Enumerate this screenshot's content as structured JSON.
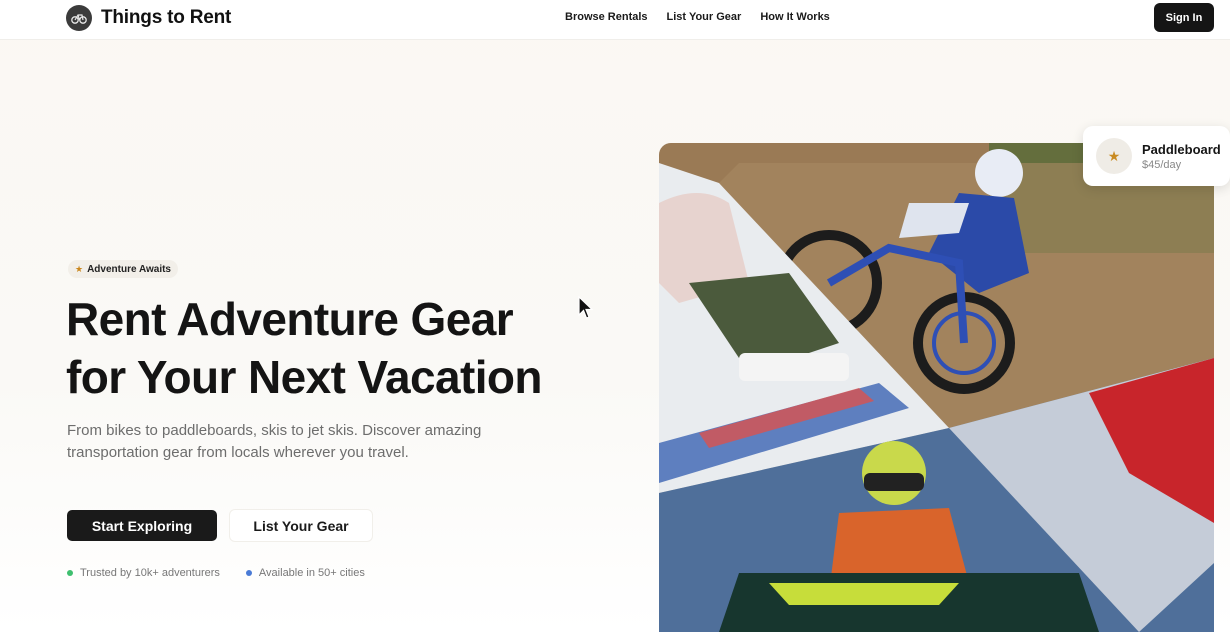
{
  "brand": {
    "name": "Things to Rent",
    "logo_icon": "bicycle-icon"
  },
  "nav": {
    "items": [
      "Browse Rentals",
      "List Your Gear",
      "How It Works"
    ]
  },
  "header": {
    "signin_label": "Sign In"
  },
  "hero": {
    "badge": {
      "icon": "surfer-icon",
      "label": "Adventure Awaits"
    },
    "headline_line1": "Rent Adventure Gear",
    "headline_line2": "for Your Next Vacation",
    "subtitle": "From bikes to paddleboards, skis to jet skis. Discover amazing transportation gear from locals wherever you travel.",
    "primary_cta": "Start Exploring",
    "secondary_cta": "List Your Gear",
    "trust": [
      {
        "label": "Trusted by 10k+ adventurers",
        "color": "#3fbf6f"
      },
      {
        "label": "Available in 50+ cities",
        "color": "#4a7bd6"
      }
    ]
  },
  "floating_card": {
    "icon": "surfer-icon",
    "title": "Paddleboard",
    "price": "$45/day"
  },
  "colors": {
    "primary": "#1a1a1a",
    "accent": "#c9861d",
    "background": "#fbf8f3"
  }
}
